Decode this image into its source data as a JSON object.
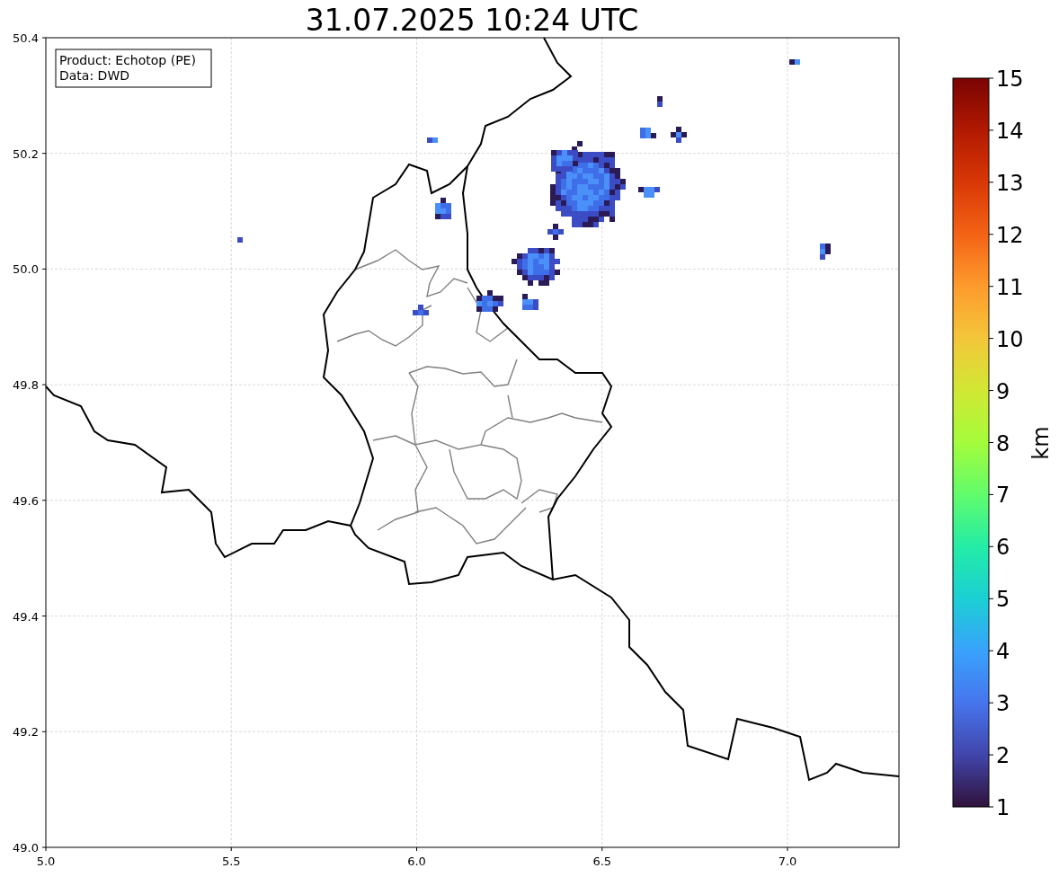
{
  "title": "31.07.2025 10:24 UTC",
  "info_box": {
    "lines": [
      "Product: Echotop (PE)",
      "Data: DWD"
    ]
  },
  "map": {
    "xticks": [
      "5.0",
      "5.5",
      "6.0",
      "6.5",
      "7.0"
    ],
    "yticks": [
      "50.4",
      "50.2",
      "50.0",
      "49.8",
      "49.6",
      "49.4",
      "49.2",
      "49.0"
    ]
  },
  "colorbar": {
    "ticks": [
      "15",
      "14",
      "13",
      "12",
      "11",
      "10",
      "9",
      "8",
      "7",
      "6",
      "5",
      "4",
      "3",
      "2",
      "1"
    ],
    "label": "km"
  }
}
